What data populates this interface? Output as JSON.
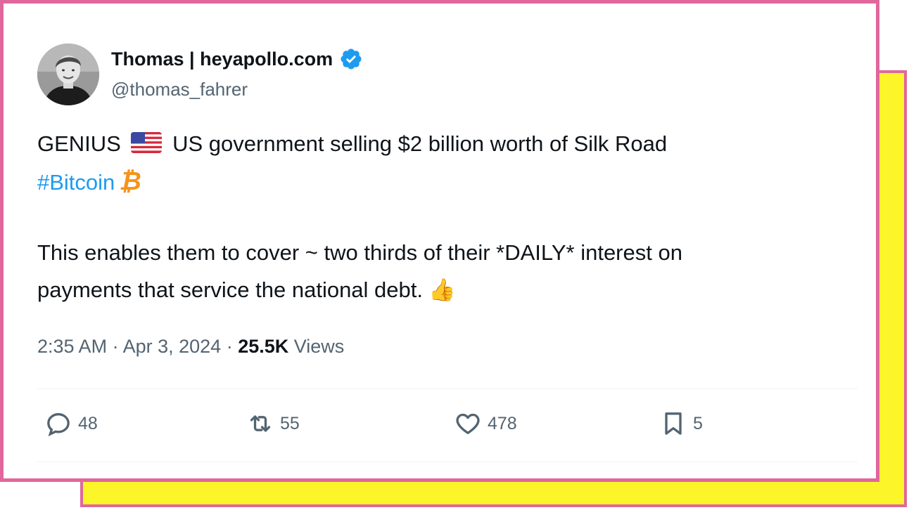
{
  "colors": {
    "frame": "#e0679c",
    "shadow": "#fbf52a",
    "link": "#1d9bf0",
    "verified": "#1d9bf0",
    "muted": "#536471"
  },
  "author": {
    "display_name": "Thomas | heyapollo.com",
    "handle": "@thomas_fahrer",
    "verified_icon": "verified-badge-icon",
    "avatar": "avatar-photo"
  },
  "tweet": {
    "line1_prefix": "GENIUS",
    "line1_flag_icon": "us-flag-icon",
    "line1_suffix": "US government selling $2 billion worth of Silk Road",
    "hashtag": "#Bitcoin",
    "bitcoin_symbol": "₿",
    "line3": "This enables them to cover ~ two thirds of their *DAILY* interest on",
    "line4": "payments that service the national debt.",
    "thumbs_up": "👍"
  },
  "meta": {
    "time": "2:35 AM",
    "sep1": " · ",
    "date": "Apr 3, 2024",
    "sep2": " · ",
    "views_count": "25.5K",
    "views_label": " Views"
  },
  "actions": {
    "replies": "48",
    "reposts": "55",
    "likes": "478",
    "bookmarks": "5"
  }
}
